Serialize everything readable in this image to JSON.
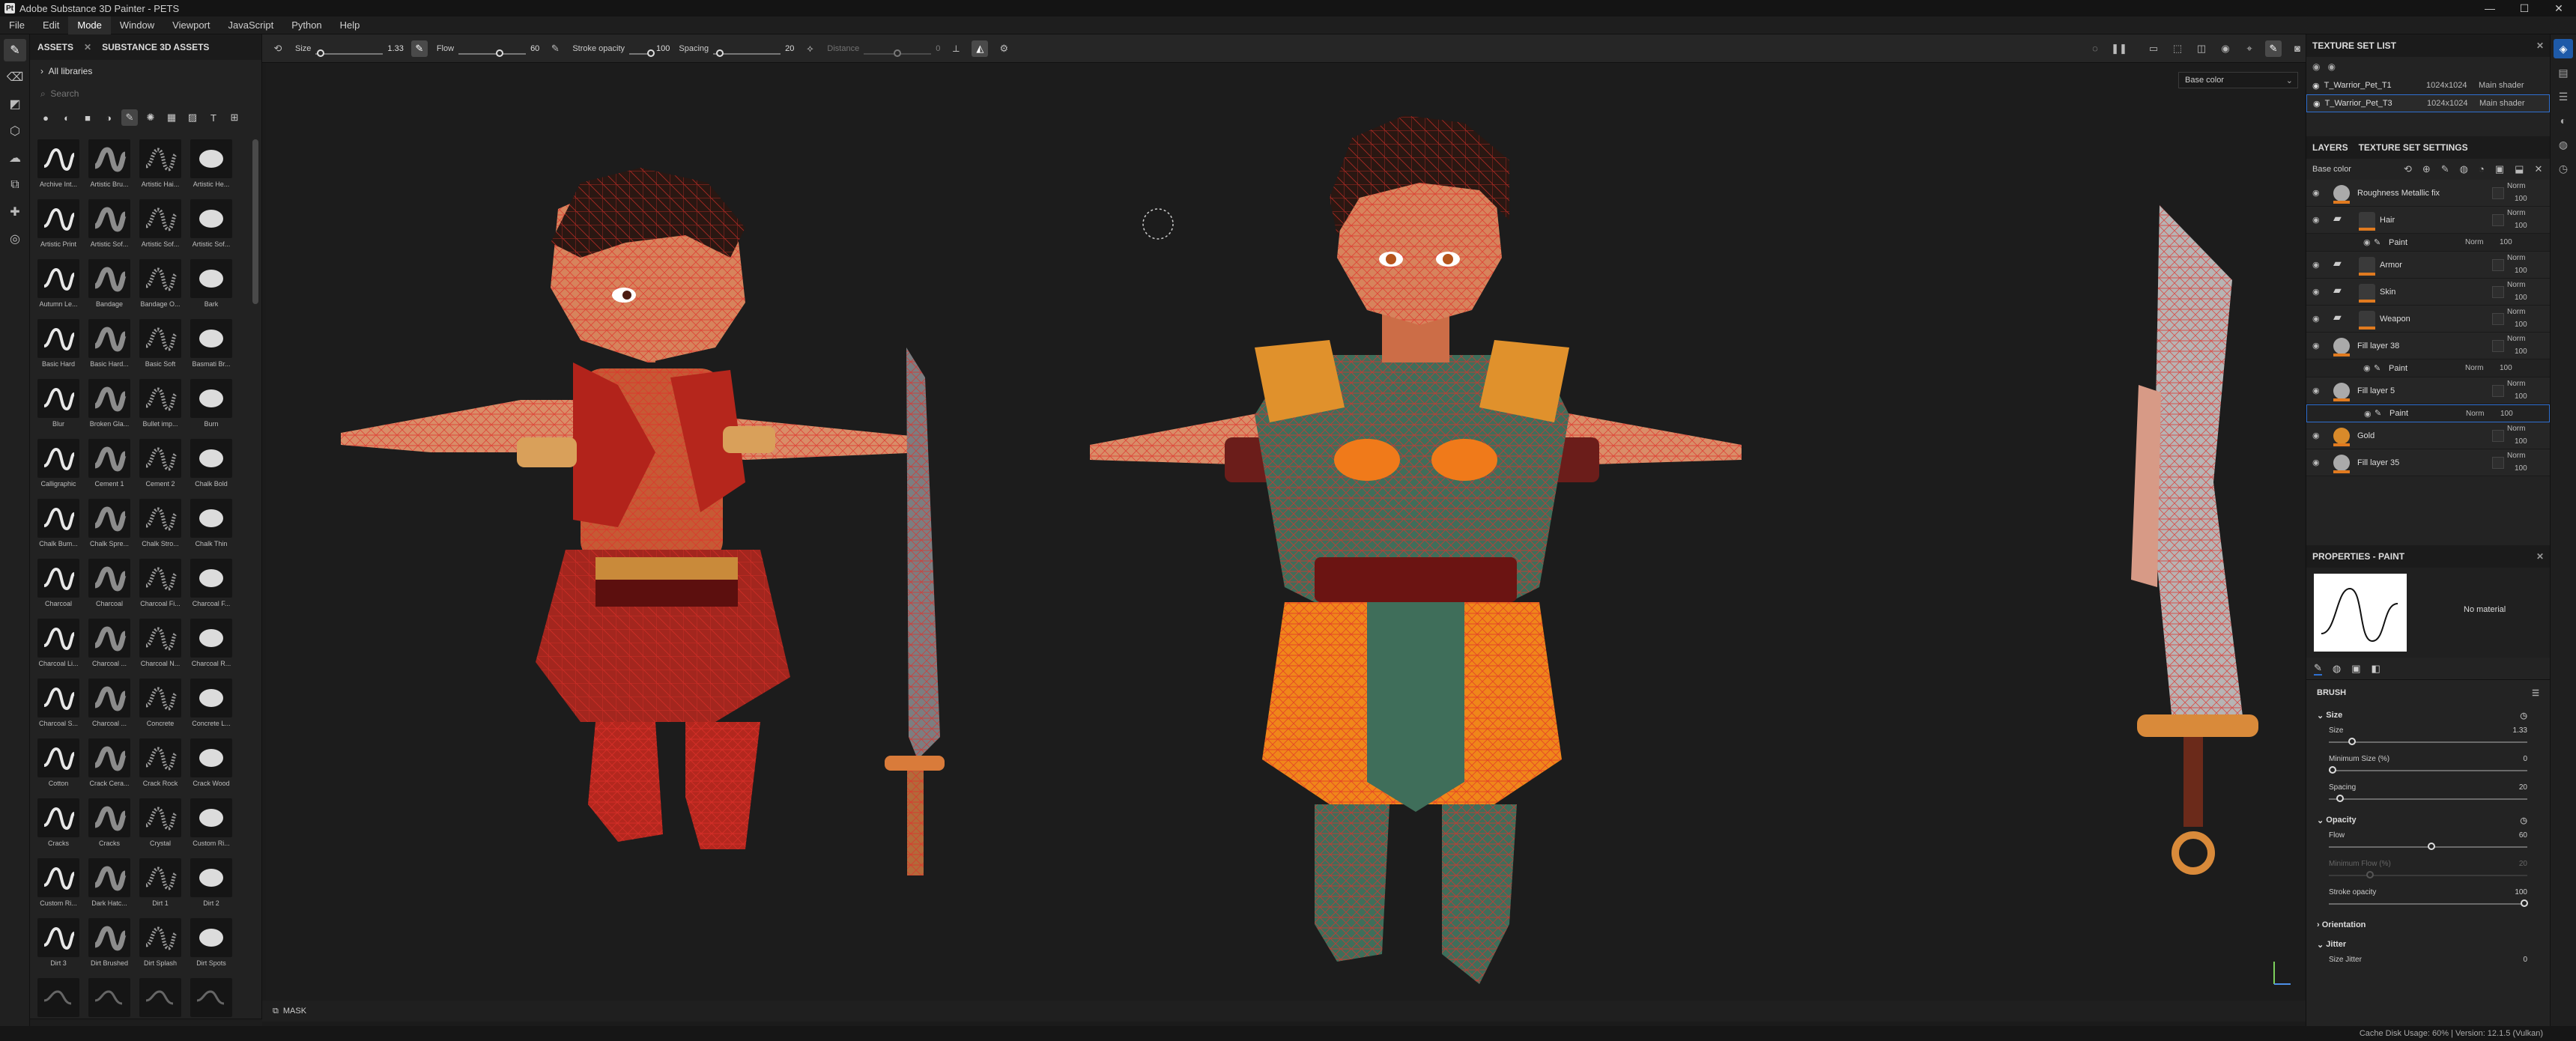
{
  "window": {
    "title": "Adobe Substance 3D Painter - PETS",
    "logo": "Pt",
    "controls": [
      "—",
      "☐",
      "✕"
    ]
  },
  "menu": [
    "File",
    "Edit",
    "Mode",
    "Window",
    "Viewport",
    "JavaScript",
    "Python",
    "Help"
  ],
  "menu_active": "Mode",
  "assets": {
    "tab_assets": "ASSETS",
    "tab_close": "✕",
    "tab_substance": "SUBSTANCE 3D ASSETS",
    "library": "All libraries",
    "search_placeholder": "Search",
    "items": [
      "Archive Int...",
      "Artistic Bru...",
      "Artistic Hai...",
      "Artistic He...",
      "Artistic Print",
      "Artistic Sof...",
      "Artistic Sof...",
      "Artistic Sof...",
      "Autumn Le...",
      "Bandage",
      "Bandage O...",
      "Bark",
      "Basic Hard",
      "Basic Hard...",
      "Basic Soft",
      "Basmati Br...",
      "Blur",
      "Broken Gla...",
      "Bullet imp...",
      "Burn",
      "Calligraphic",
      "Cement 1",
      "Cement 2",
      "Chalk Bold",
      "Chalk Bum...",
      "Chalk Spre...",
      "Chalk Stro...",
      "Chalk Thin",
      "Charcoal",
      "Charcoal",
      "Charcoal Fi...",
      "Charcoal F...",
      "Charcoal Li...",
      "Charcoal ...",
      "Charcoal N...",
      "Charcoal R...",
      "Charcoal S...",
      "Charcoal ...",
      "Concrete",
      "Concrete L...",
      "Cotton",
      "Crack Cera...",
      "Crack Rock",
      "Crack Wood",
      "Cracks",
      "Cracks",
      "Crystal",
      "Custom Ri...",
      "Custom Ri...",
      "Dark Hatc...",
      "Dirt 1",
      "Dirt 2",
      "Dirt 3",
      "Dirt Brushed",
      "Dirt Splash",
      "Dirt Spots",
      "",
      "",
      "",
      ""
    ]
  },
  "toolbar": {
    "size_label": "Size",
    "size_value": "1.33",
    "flow_label": "Flow",
    "flow_value": "60",
    "stroke_label": "Stroke opacity",
    "stroke_value": "100",
    "spacing_label": "Spacing",
    "spacing_value": "20",
    "distance_label": "Distance",
    "distance_value": "0"
  },
  "viewport": {
    "channel": "Base color",
    "channel_caret": "⌄"
  },
  "mask": {
    "label": "MASK"
  },
  "texture_sets": {
    "title": "TEXTURE SET LIST",
    "rows": [
      {
        "name": "T_Warrior_Pet_T1",
        "res": "1024x1024",
        "shader": "Main shader"
      },
      {
        "name": "T_Warrior_Pet_T3",
        "res": "1024x1024",
        "shader": "Main shader"
      }
    ]
  },
  "layers": {
    "tab_layers": "LAYERS",
    "tab_settings": "TEXTURE SET SETTINGS",
    "channel": "Base color",
    "blend": "Norm",
    "opacity": "100",
    "rows": [
      {
        "name": "Roughness Metallic fix",
        "type": "fill"
      },
      {
        "name": "Hair",
        "type": "folder"
      },
      {
        "name": "Paint",
        "type": "paint"
      },
      {
        "name": "Armor",
        "type": "folder"
      },
      {
        "name": "Skin",
        "type": "folder"
      },
      {
        "name": "Weapon",
        "type": "folder"
      },
      {
        "name": "Fill layer 38",
        "type": "fill"
      },
      {
        "name": "Paint",
        "type": "paint"
      },
      {
        "name": "Fill layer 5",
        "type": "fill"
      },
      {
        "name": "Paint",
        "type": "paint"
      },
      {
        "name": "Gold",
        "type": "fill"
      },
      {
        "name": "Fill layer 35",
        "type": "fill"
      }
    ]
  },
  "properties": {
    "title": "PROPERTIES - PAINT",
    "no_material": "No material",
    "brush_title": "BRUSH",
    "size_section": "Size",
    "size_label": "Size",
    "size_value": "1.33",
    "min_size_label": "Minimum Size (%)",
    "min_size_value": "0",
    "spacing_label": "Spacing",
    "spacing_value": "20",
    "opacity_section": "Opacity",
    "flow_label": "Flow",
    "flow_value": "60",
    "min_flow_label": "Minimum Flow (%)",
    "min_flow_value": "20",
    "stroke_label": "Stroke opacity",
    "stroke_value": "100",
    "orientation_section": "Orientation",
    "jitter_section": "Jitter",
    "size_jitter_label": "Size Jitter",
    "size_jitter_value": "0"
  },
  "status": {
    "text": "Cache Disk Usage:   60%  |  Version: 12.1.5 (Vulkan)"
  },
  "colors": {
    "accent": "#2f6fd0",
    "wire": "#e0302a",
    "layer_orange": "#e07a1f",
    "panel": "#232323"
  }
}
